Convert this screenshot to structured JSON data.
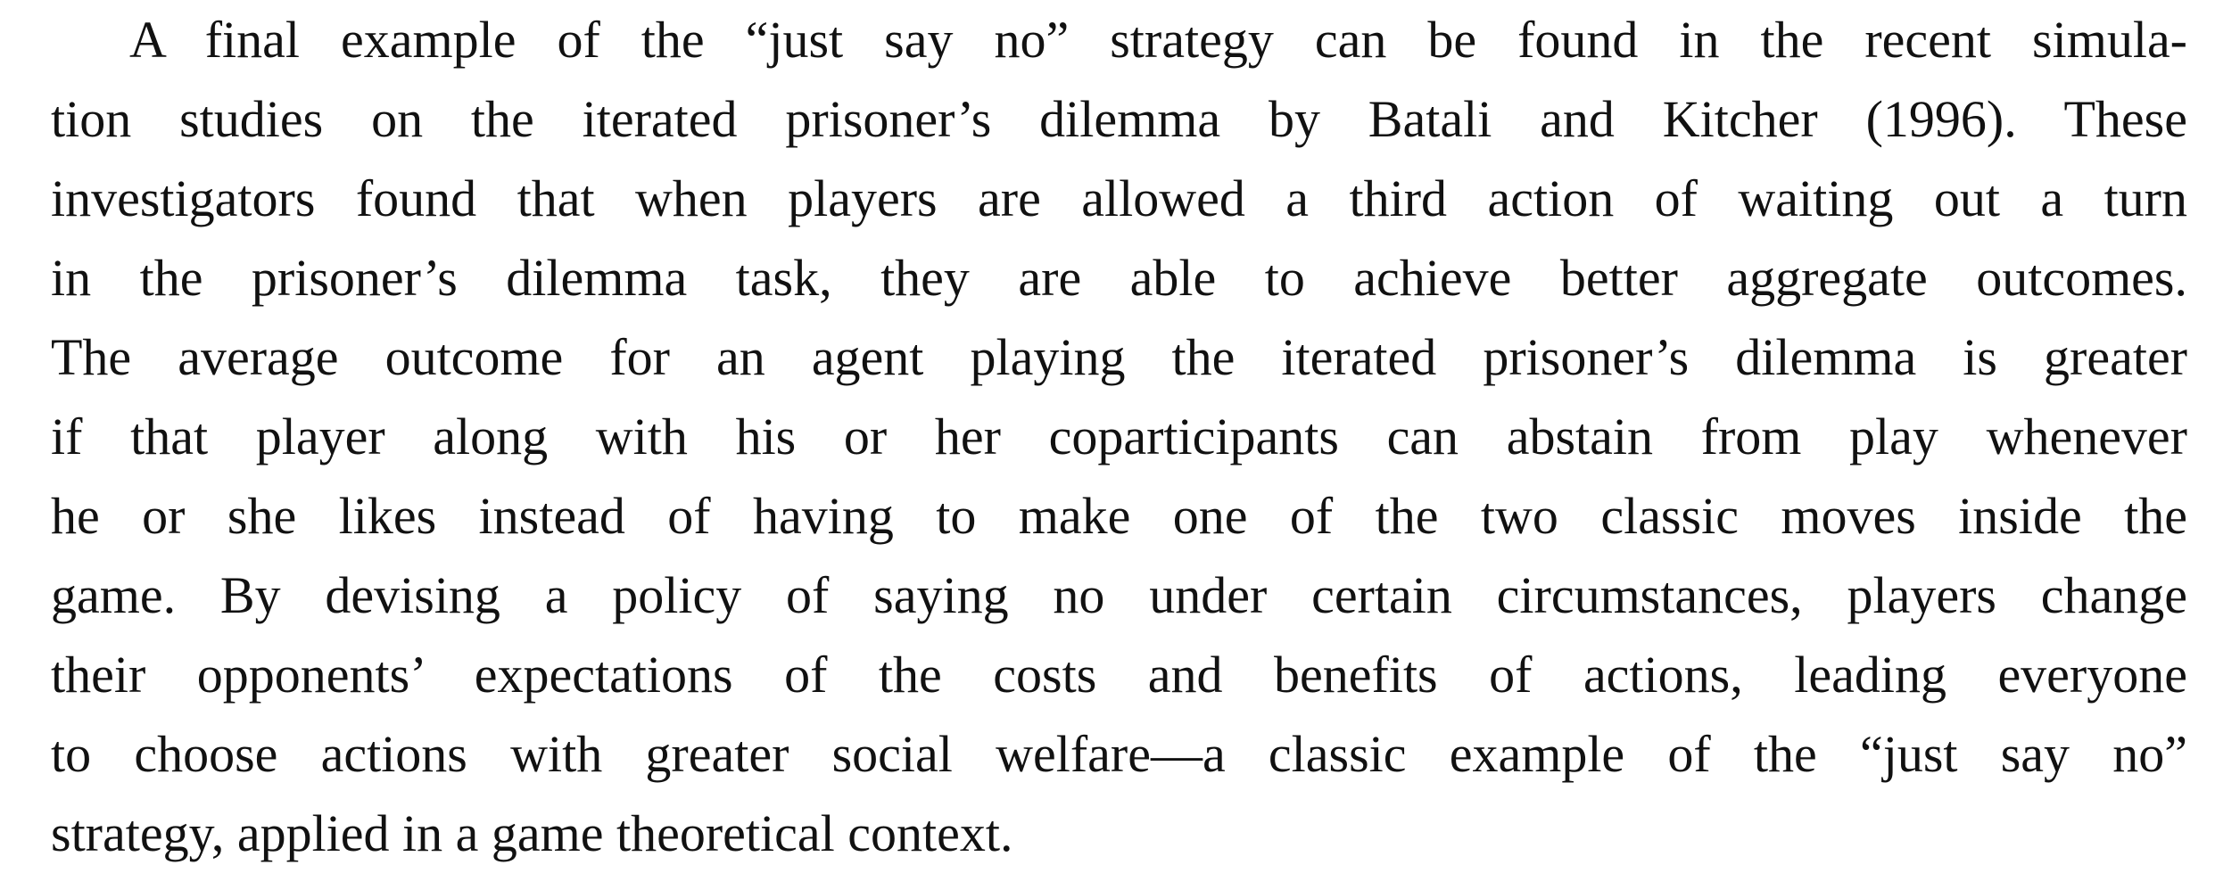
{
  "document": {
    "paragraph_lines": [
      "A final example of the “just say no” strategy can be found in the recent simula-",
      "tion studies on the iterated prisoner’s dilemma by Batali and Kitcher (1996).  These",
      "investigators found that when players are allowed a third action of waiting out a turn",
      "in the prisoner’s dilemma task, they are able to achieve better aggregate outcomes.",
      "The average outcome for an agent playing the iterated prisoner’s dilemma is greater",
      "if that player along with his or her coparticipants can abstain from play whenever",
      "he or she likes instead of having to make one of the two classic moves inside the",
      "game.  By devising a policy of saying no under certain circumstances, players change",
      "their opponents’ expectations of the costs and benefits of actions, leading everyone",
      "to choose actions with greater social welfare—a classic example of the “just say no”",
      "strategy, applied in a game theoretical context."
    ]
  }
}
